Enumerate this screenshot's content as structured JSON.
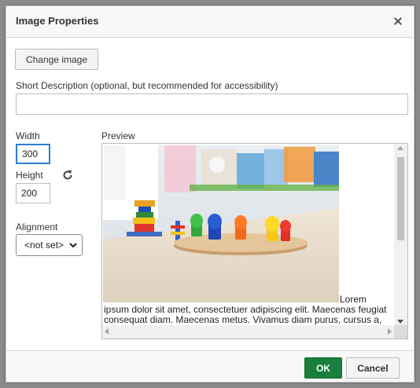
{
  "dialog": {
    "title": "Image Properties",
    "close_icon": "close-icon"
  },
  "change_image_label": "Change image",
  "description": {
    "label": "Short Description (optional, but recommended for accessibility)",
    "value": ""
  },
  "width": {
    "label": "Width",
    "value": "300"
  },
  "height": {
    "label": "Height",
    "value": "200"
  },
  "lock_icon": "refresh-lock-icon",
  "alignment": {
    "label": "Alignment",
    "selected": "<not set>"
  },
  "preview": {
    "label": "Preview",
    "image_alt": "Toy shape sorter with colorful pegs in a classroom",
    "text_lines": [
      "Lorem",
      "ipsum dolor sit amet, consectetuer adipiscing elit. Maecenas feugiat",
      "consequat diam. Maecenas metus. Vivamus diam purus, cursus a,"
    ]
  },
  "footer": {
    "ok_label": "OK",
    "cancel_label": "Cancel"
  },
  "colors": {
    "ok": "#1a7f3c",
    "focus": "#2a7fd4"
  }
}
